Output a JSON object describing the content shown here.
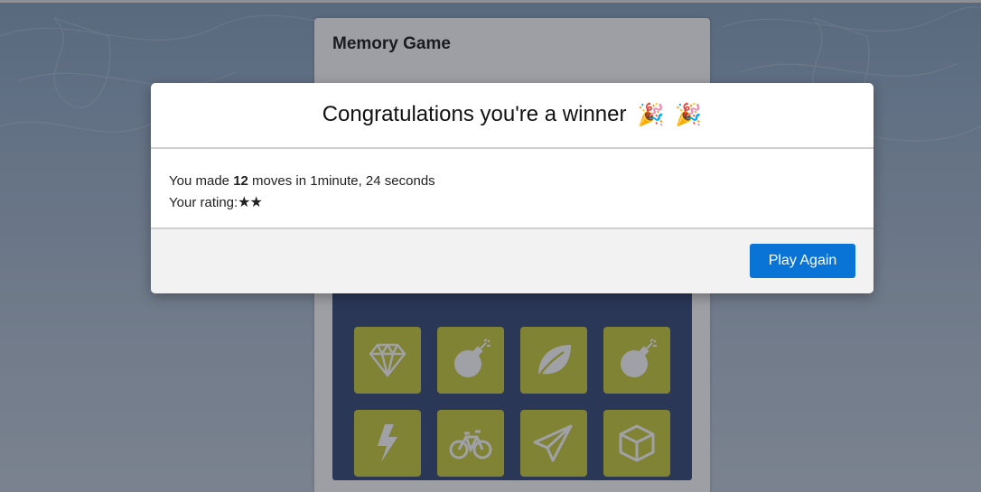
{
  "game": {
    "title": "Memory Game",
    "cards": [
      {
        "icon": "diamond-icon"
      },
      {
        "icon": "bomb-icon"
      },
      {
        "icon": "leaf-icon"
      },
      {
        "icon": "bomb-icon"
      },
      {
        "icon": "bolt-icon"
      },
      {
        "icon": "bicycle-icon"
      },
      {
        "icon": "paper-plane-icon"
      },
      {
        "icon": "cube-icon"
      }
    ],
    "card_color": "#bfc030",
    "deck_color": "#2c3e6b"
  },
  "modal": {
    "title": "Congratulations you're a winner",
    "emoji_1": "🎉",
    "emoji_2": "🎉",
    "moves_prefix": "You made",
    "moves_count": "12",
    "moves_suffix": "moves in 1minute, 24 seconds",
    "rating_label": "Your rating:",
    "rating_stars": "★★",
    "button_label": "Play Again",
    "button_color": "#0a74d6"
  }
}
